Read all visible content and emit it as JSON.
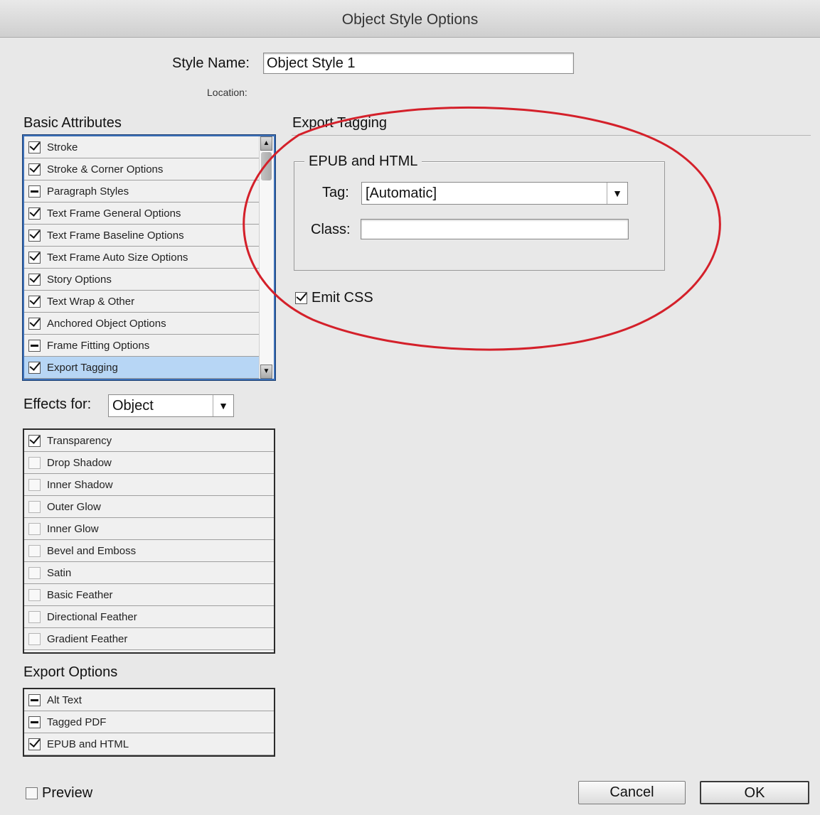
{
  "dialog": {
    "title": "Object Style Options"
  },
  "style_name": {
    "label": "Style Name:",
    "value": "Object Style 1"
  },
  "location": {
    "label": "Location:"
  },
  "basic_attributes": {
    "heading": "Basic Attributes",
    "items": [
      {
        "label": "Stroke",
        "state": "on"
      },
      {
        "label": "Stroke & Corner Options",
        "state": "on"
      },
      {
        "label": "Paragraph Styles",
        "state": "mixed"
      },
      {
        "label": "Text Frame General Options",
        "state": "on"
      },
      {
        "label": "Text Frame Baseline Options",
        "state": "on"
      },
      {
        "label": "Text Frame Auto Size Options",
        "state": "on"
      },
      {
        "label": "Story Options",
        "state": "on"
      },
      {
        "label": "Text Wrap & Other",
        "state": "on"
      },
      {
        "label": "Anchored Object Options",
        "state": "on"
      },
      {
        "label": "Frame Fitting Options",
        "state": "mixed"
      },
      {
        "label": "Export Tagging",
        "state": "on",
        "selected": true
      }
    ]
  },
  "effects": {
    "label": "Effects for:",
    "selected": "Object",
    "items": [
      {
        "label": "Transparency",
        "state": "on"
      },
      {
        "label": "Drop Shadow",
        "state": "off"
      },
      {
        "label": "Inner Shadow",
        "state": "off"
      },
      {
        "label": "Outer Glow",
        "state": "off"
      },
      {
        "label": "Inner Glow",
        "state": "off"
      },
      {
        "label": "Bevel and Emboss",
        "state": "off"
      },
      {
        "label": "Satin",
        "state": "off"
      },
      {
        "label": "Basic Feather",
        "state": "off"
      },
      {
        "label": "Directional Feather",
        "state": "off"
      },
      {
        "label": "Gradient Feather",
        "state": "off"
      }
    ]
  },
  "export_options": {
    "heading": "Export Options",
    "items": [
      {
        "label": "Alt Text",
        "state": "mixed"
      },
      {
        "label": "Tagged PDF",
        "state": "mixed"
      },
      {
        "label": "EPUB and HTML",
        "state": "on"
      }
    ]
  },
  "export_tagging": {
    "heading": "Export Tagging",
    "group_title": "EPUB and HTML",
    "tag_label": "Tag:",
    "tag_value": "[Automatic]",
    "class_label": "Class:",
    "class_value": "",
    "emit_css_label": "Emit CSS",
    "emit_css_checked": true
  },
  "footer": {
    "preview_label": "Preview",
    "preview_checked": false,
    "cancel_label": "Cancel",
    "ok_label": "OK"
  },
  "colors": {
    "annotation": "#d4202a",
    "selection": "#b7d6f5",
    "focus_border": "#3b6fb7"
  }
}
